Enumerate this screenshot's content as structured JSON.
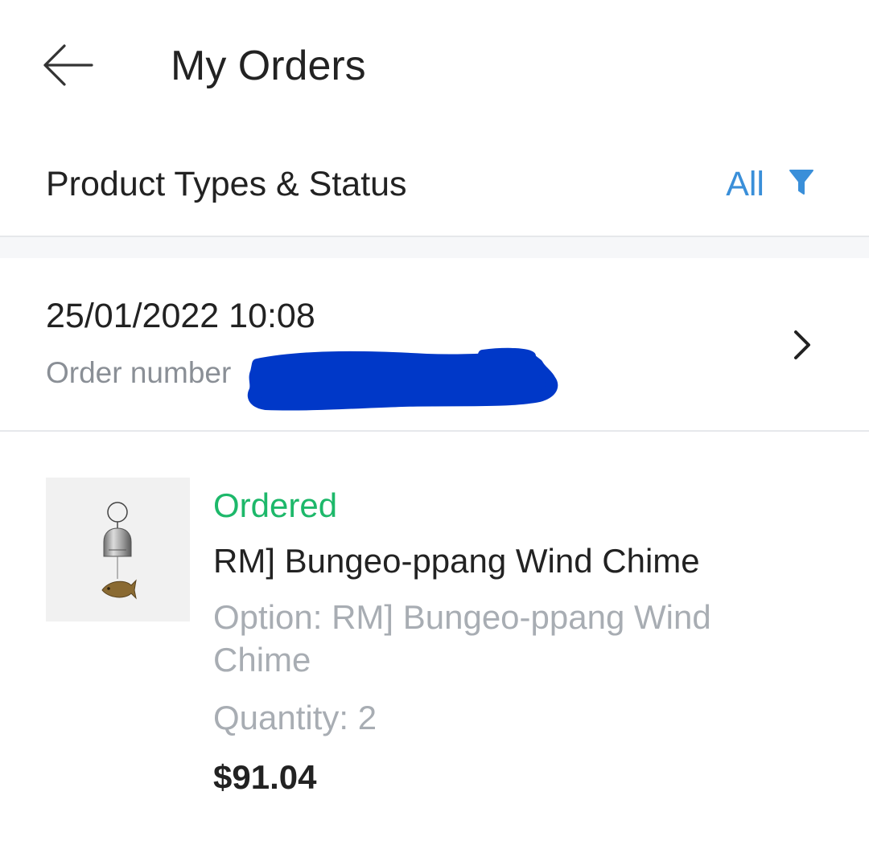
{
  "header": {
    "title": "My Orders",
    "back_icon": "arrow-left-icon"
  },
  "filter": {
    "label": "Product Types & Status",
    "value": "All",
    "icon": "filter-funnel-icon",
    "accent_color": "#3a8fd9"
  },
  "order": {
    "date": "25/01/2022 10:08",
    "number_label": "Order number",
    "number_value_redacted": true,
    "redaction_color": "#0038c8",
    "chevron_icon": "chevron-right-icon"
  },
  "item": {
    "status": "Ordered",
    "status_color": "#1db86a",
    "name": "RM] Bungeo-ppang Wind Chime",
    "option": "Option: RM] Bungeo-ppang Wind Chime",
    "quantity": "Quantity: 2",
    "price": "$91.04",
    "image_icon": "wind-chime-product-image"
  }
}
